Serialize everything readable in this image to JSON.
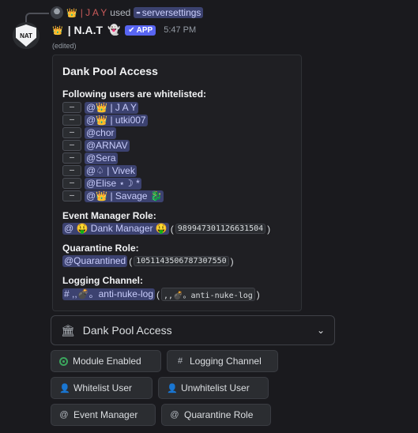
{
  "reply": {
    "name": "| J A Y",
    "used_text": "used",
    "command": "serversettings"
  },
  "message": {
    "author": "| N.A.T",
    "app_badge": "APP",
    "time": "5:47 PM",
    "edited": "(edited)",
    "avatar_text": "NAT"
  },
  "embed": {
    "title": "Dank Pool Access",
    "whitelist_title": "Following users are whitelisted:",
    "users": [
      {
        "dash": "–",
        "mention": "@👑 | J A Y"
      },
      {
        "dash": "–",
        "mention": "@👑 | utki007"
      },
      {
        "dash": "–",
        "mention": "@chor"
      },
      {
        "dash": "–",
        "mention": "@ARNAV"
      },
      {
        "dash": "–",
        "mention": "@Sera"
      },
      {
        "dash": "–",
        "mention": "@♤ | Vivek"
      },
      {
        "dash": "–",
        "mention": "@Elise ⋆☽ *"
      },
      {
        "dash": "–",
        "mention": "@👑 | Savage 🐉"
      }
    ],
    "event_manager": {
      "name": "Event Manager Role:",
      "mention": "@ 🤑 Dank Manager 🤑 ",
      "id": "989947301126631504"
    },
    "quarantine": {
      "name": "Quarantine Role:",
      "mention": "@Quarantined",
      "id": "1051143506787307550"
    },
    "logging": {
      "name": "Logging Channel:",
      "mention": "# ,,💣。anti-nuke-log",
      "code": ",,💣。anti-nuke-log"
    }
  },
  "select": {
    "label": "Dank Pool Access"
  },
  "buttons": {
    "module": "Module Enabled",
    "logging": "Logging Channel",
    "whitelist": "Whitelist User",
    "unwhitelist": "Unwhitelist User",
    "event_manager": "Event Manager",
    "quarantine": "Quarantine Role"
  },
  "colors": {
    "accent": "#5865f2",
    "mention_bg": "#3c4270",
    "enabled": "#3ba55d"
  }
}
